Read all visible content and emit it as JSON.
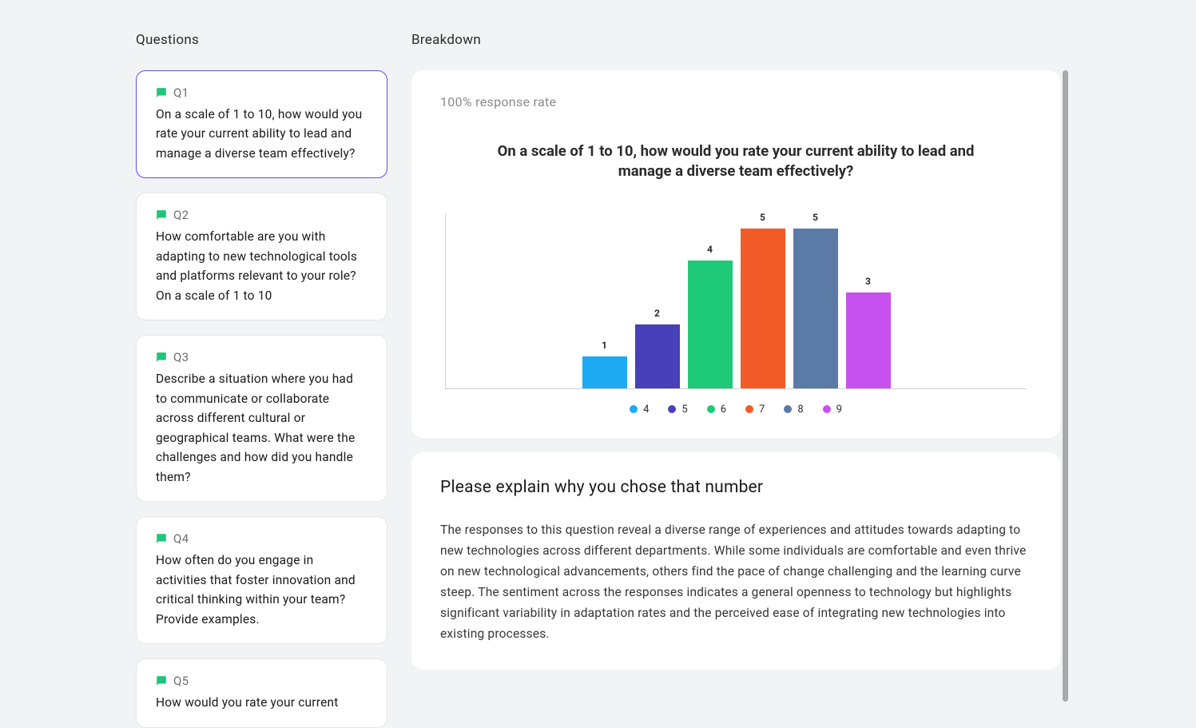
{
  "panels": {
    "questions_title": "Questions",
    "breakdown_title": "Breakdown"
  },
  "questions": [
    {
      "label": "Q1",
      "text": "On a scale of 1 to 10, how would you rate your current ability to lead and manage a diverse team effectively?",
      "selected": true
    },
    {
      "label": "Q2",
      "text": "How comfortable are you with adapting to new technological tools and platforms relevant to your role? On a scale of 1 to 10",
      "selected": false
    },
    {
      "label": "Q3",
      "text": "Describe a situation where you had to communicate or collaborate across different cultural or geographical teams. What were the challenges and how did you handle them?",
      "selected": false
    },
    {
      "label": "Q4",
      "text": "How often do you engage in activities that foster innovation and critical thinking within your team? Provide examples.",
      "selected": false
    },
    {
      "label": "Q5",
      "text": "How would you rate your current",
      "selected": false
    }
  ],
  "breakdown": {
    "response_rate": "100% response rate",
    "chart_title": "On a scale of 1 to 10, how would you rate your current ability to lead and manage a diverse team effectively?",
    "summary_title": "Please explain why you chose that number",
    "summary_text": "The responses to this question reveal a diverse range of experiences and attitudes towards adapting to new technologies across different departments. While some individuals are comfortable and even thrive on new technological advancements, others find the pace of change challenging and the learning curve steep. The sentiment across the responses indicates a general openness to technology but highlights significant variability in adaptation rates and the perceived ease of integrating new technologies into existing processes."
  },
  "chart_data": {
    "type": "bar",
    "title": "On a scale of 1 to 10, how would you rate your current ability to lead and manage a diverse team effectively?",
    "categories": [
      "4",
      "5",
      "6",
      "7",
      "8",
      "9"
    ],
    "values": [
      1,
      2,
      4,
      5,
      5,
      3
    ],
    "colors": [
      "#1ea9f3",
      "#4740b8",
      "#1ec978",
      "#f25b27",
      "#5b7ba6",
      "#c651ef"
    ],
    "ylim": [
      0,
      5
    ],
    "legend": [
      {
        "label": "4",
        "color": "#1ea9f3"
      },
      {
        "label": "5",
        "color": "#4740b8"
      },
      {
        "label": "6",
        "color": "#1ec978"
      },
      {
        "label": "7",
        "color": "#f25b27"
      },
      {
        "label": "8",
        "color": "#5b7ba6"
      },
      {
        "label": "9",
        "color": "#c651ef"
      }
    ]
  }
}
